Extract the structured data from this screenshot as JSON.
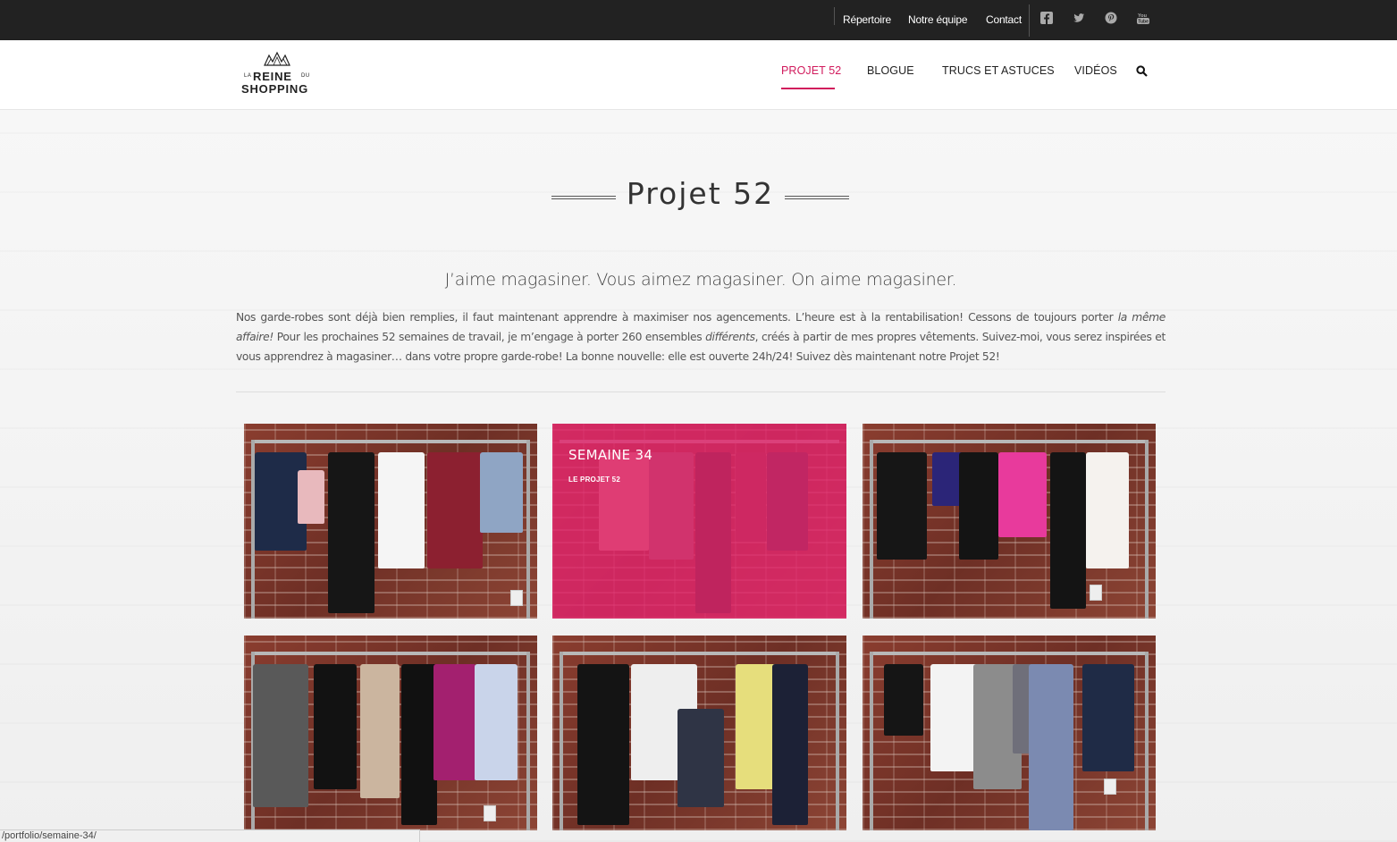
{
  "topbar": {
    "links": [
      "Répertoire",
      "Notre équipe",
      "Contact"
    ],
    "social_icons": [
      "facebook-icon",
      "twitter-icon",
      "pinterest-icon",
      "youtube-icon"
    ]
  },
  "logo": {
    "la": "LA",
    "reine": "REINE",
    "du": "DU",
    "shopping": "SHOPPING"
  },
  "nav": {
    "items": [
      "PROJET 52",
      "BLOGUE",
      "TRUCS ET ASTUCES",
      "VIDÉOS"
    ],
    "active": "PROJET 52",
    "accent_color": "#d11a5c"
  },
  "page": {
    "title": "Projet 52",
    "subtitle": "J’aime magasiner. Vous aimez magasiner. On aime magasiner.",
    "intro_1": "Nos garde-robes sont déjà bien remplies, il faut maintenant apprendre à maximiser nos agencements. L’heure est à la rentabilisation! Cessons de toujours porter ",
    "intro_em1": "la même affaire!",
    "intro_2": " Pour les prochaines 52 semaines de travail, je m’engage à porter 260 ensembles ",
    "intro_em2": "différents",
    "intro_3": ", créés à partir de mes propres vêtements.  Suivez-moi, vous serez inspirées et vous apprendrez à magasiner… dans votre propre garde-robe! La bonne nouvelle: elle est ouverte 24h/24! Suivez dès maintenant notre Projet 52!"
  },
  "portfolio": {
    "hover_tile": {
      "title": "SEMAINE 34",
      "category": "LE PROJET 52",
      "overlay_color": "#e3266c"
    }
  },
  "statusbar": {
    "url": "/portfolio/semaine-34/"
  }
}
